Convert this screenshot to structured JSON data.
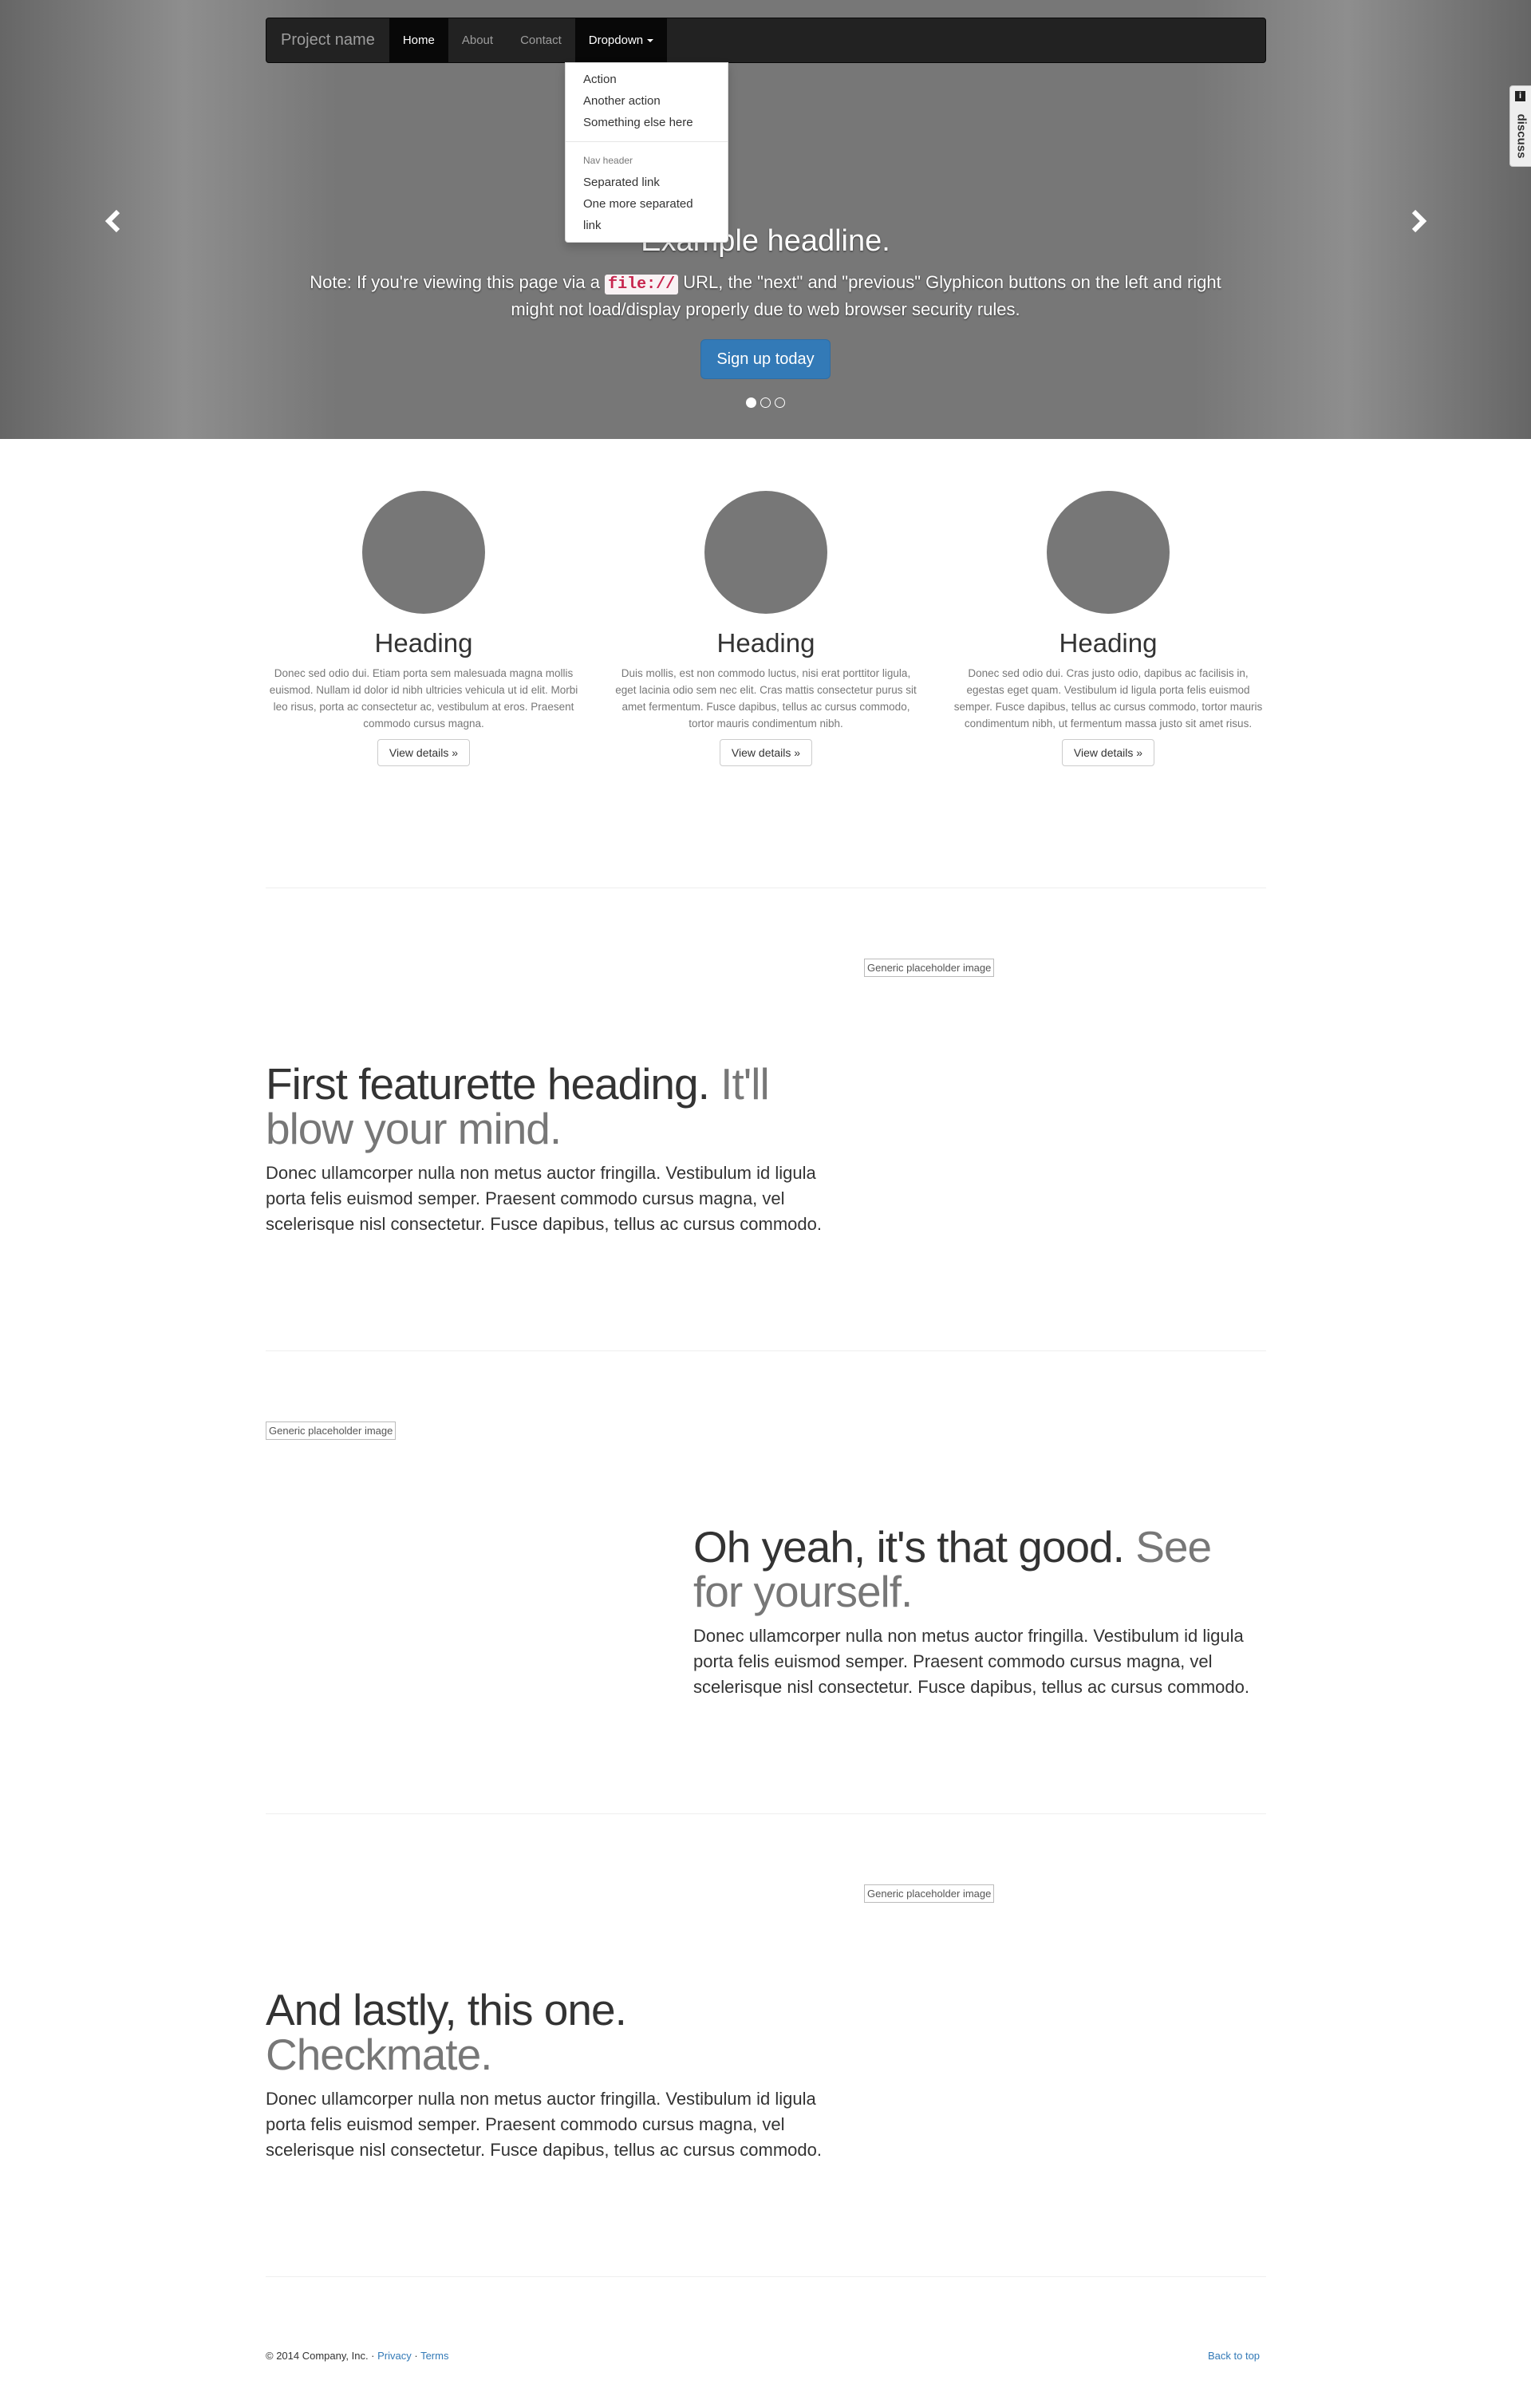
{
  "navbar": {
    "brand": "Project name",
    "items": [
      {
        "label": "Home"
      },
      {
        "label": "About"
      },
      {
        "label": "Contact"
      },
      {
        "label": "Dropdown"
      }
    ]
  },
  "dropdown": {
    "items": [
      "Action",
      "Another action",
      "Something else here"
    ],
    "header": "Nav header",
    "items2": [
      "Separated link",
      "One more separated link"
    ]
  },
  "discuss": {
    "label": "discuss",
    "info_icon": "i"
  },
  "carousel": {
    "headline": "Example headline.",
    "note_before": "Note: If you're viewing this page via a ",
    "note_code": "file://",
    "note_after": " URL, the \"next\" and \"previous\" Glyphicon buttons on the left and right might not load/display properly due to web browser security rules.",
    "button": "Sign up today",
    "slides": 3,
    "active_slide": 1
  },
  "columns": [
    {
      "heading": "Heading",
      "text": "Donec sed odio dui. Etiam porta sem malesuada magna mollis euismod. Nullam id dolor id nibh ultricies vehicula ut id elit. Morbi leo risus, porta ac consectetur ac, vestibulum at eros. Praesent commodo cursus magna.",
      "button": "View details »"
    },
    {
      "heading": "Heading",
      "text": "Duis mollis, est non commodo luctus, nisi erat porttitor ligula, eget lacinia odio sem nec elit. Cras mattis consectetur purus sit amet fermentum. Fusce dapibus, tellus ac cursus commodo, tortor mauris condimentum nibh.",
      "button": "View details »"
    },
    {
      "heading": "Heading",
      "text": "Donec sed odio dui. Cras justo odio, dapibus ac facilisis in, egestas eget quam. Vestibulum id ligula porta felis euismod semper. Fusce dapibus, tellus ac cursus commodo, tortor mauris condimentum nibh, ut fermentum massa justo sit amet risus.",
      "button": "View details »"
    }
  ],
  "featurettes": [
    {
      "heading": "First featurette heading.",
      "muted": "It'll blow your mind.",
      "text": "Donec ullamcorper nulla non metus auctor fringilla. Vestibulum id ligula porta felis euismod semper. Praesent commodo cursus magna, vel scelerisque nisl consectetur. Fusce dapibus, tellus ac cursus commodo.",
      "image_alt": "Generic placeholder image"
    },
    {
      "heading": "Oh yeah, it's that good.",
      "muted": "See for yourself.",
      "text": "Donec ullamcorper nulla non metus auctor fringilla. Vestibulum id ligula porta felis euismod semper. Praesent commodo cursus magna, vel scelerisque nisl consectetur. Fusce dapibus, tellus ac cursus commodo.",
      "image_alt": "Generic placeholder image"
    },
    {
      "heading": "And lastly, this one.",
      "muted": "Checkmate.",
      "text": "Donec ullamcorper nulla non metus auctor fringilla. Vestibulum id ligula porta felis euismod semper. Praesent commodo cursus magna, vel scelerisque nisl consectetur. Fusce dapibus, tellus ac cursus commodo.",
      "image_alt": "Generic placeholder image"
    }
  ],
  "footer": {
    "copyright": "© 2014 Company, Inc. · ",
    "privacy": "Privacy",
    "sep": " · ",
    "terms": "Terms",
    "back_to_top": "Back to top"
  },
  "colors": {
    "navbar_bg": "#222222",
    "primary": "#337ab7",
    "circle": "#777777",
    "code_text": "#c7254e"
  }
}
